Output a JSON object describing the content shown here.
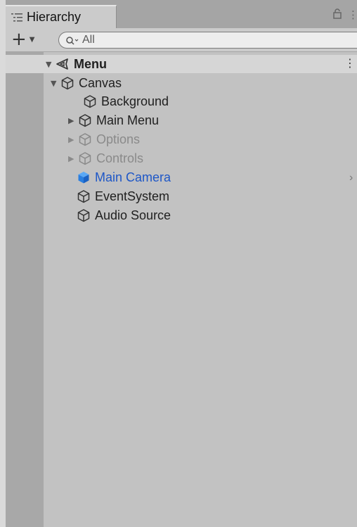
{
  "window": {
    "tab_label": "Hierarchy",
    "tab_icon": "list-icon",
    "lock_icon": "lock-icon",
    "menu_icon": "kebab-menu-icon"
  },
  "toolbar": {
    "add_label": "+",
    "add_dropdown": "▼",
    "search_placeholder": "All",
    "search_value": ""
  },
  "scene": {
    "name": "Menu",
    "menu_glyph": "⋮",
    "expand_glyph": "▼"
  },
  "tree": [
    {
      "name": "Canvas",
      "arrow": "▼",
      "state": "normal",
      "icon": "gameobject-cube-icon"
    },
    {
      "name": "Background",
      "arrow": "",
      "state": "normal",
      "icon": "gameobject-cube-icon"
    },
    {
      "name": "Main Menu",
      "arrow": "▶",
      "state": "normal",
      "icon": "gameobject-cube-icon"
    },
    {
      "name": "Options",
      "arrow": "▶",
      "state": "inactive",
      "icon": "gameobject-cube-icon"
    },
    {
      "name": "Controls",
      "arrow": "▶",
      "state": "inactive",
      "icon": "gameobject-cube-icon"
    },
    {
      "name": "Main Camera",
      "arrow": "",
      "state": "selected",
      "icon": "prefab-cube-icon"
    },
    {
      "name": "EventSystem",
      "arrow": "",
      "state": "normal",
      "icon": "gameobject-cube-icon"
    },
    {
      "name": "Audio Source",
      "arrow": "",
      "state": "normal",
      "icon": "gameobject-cube-icon"
    }
  ],
  "right_chevron": "›",
  "colors": {
    "selected_text": "#1e57c7",
    "prefab_blue": "#2a7fe0",
    "inactive": "#8a8a8a"
  }
}
